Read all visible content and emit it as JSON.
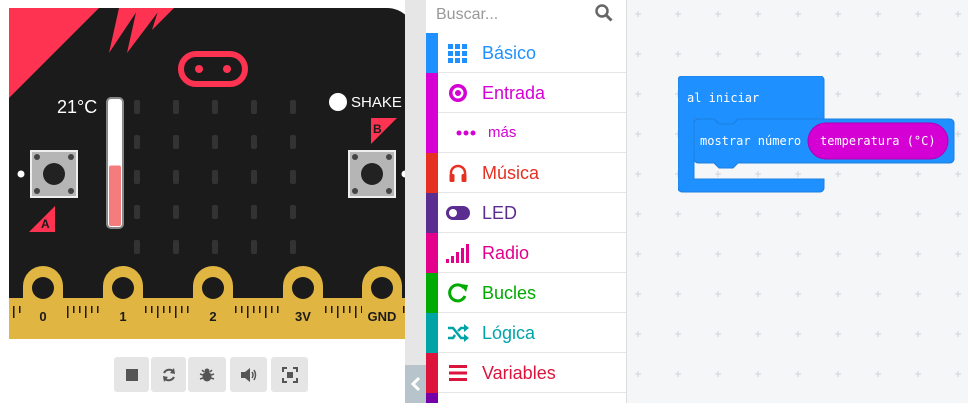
{
  "simulator": {
    "temperature_label": "21°C",
    "temperature_fraction": 0.48,
    "shake_label": "SHAKE",
    "button_a_label": "A",
    "button_b_label": "B",
    "pins": [
      "0",
      "1",
      "2",
      "3V",
      "GND"
    ],
    "controls": [
      {
        "name": "stop-icon"
      },
      {
        "name": "restart-icon"
      },
      {
        "name": "debug-bug-icon"
      },
      {
        "name": "sound-icon"
      },
      {
        "name": "fullscreen-icon"
      }
    ],
    "colors": {
      "board": "#1b1b1b",
      "accent": "#fe3351",
      "pin": "#e1b541"
    }
  },
  "toolbox": {
    "search_placeholder": "Buscar...",
    "categories": [
      {
        "label": "Básico",
        "color": "#1e90ff",
        "icon": "grid-icon"
      },
      {
        "label": "Entrada",
        "color": "#d400d4",
        "icon": "target-icon"
      },
      {
        "label": "más",
        "color": "#d400d4",
        "icon": "more-dots-icon"
      },
      {
        "label": "Música",
        "color": "#e63022",
        "icon": "headphones-icon"
      },
      {
        "label": "LED",
        "color": "#5c2d91",
        "icon": "toggle-icon"
      },
      {
        "label": "Radio",
        "color": "#e3008c",
        "icon": "signal-bars-icon"
      },
      {
        "label": "Bucles",
        "color": "#00aa00",
        "icon": "loop-arrow-icon"
      },
      {
        "label": "Lógica",
        "color": "#00a4a6",
        "icon": "shuffle-icon"
      },
      {
        "label": "Variables",
        "color": "#dc143c",
        "icon": "list-lines-icon"
      }
    ]
  },
  "workspace": {
    "event_block": {
      "label": "al iniciar",
      "color": "#1e90ff"
    },
    "statement_block": {
      "label": "mostrar número",
      "color": "#1e90ff"
    },
    "reporter_block": {
      "label": "temperatura (°C)",
      "color": "#d400d4"
    }
  }
}
